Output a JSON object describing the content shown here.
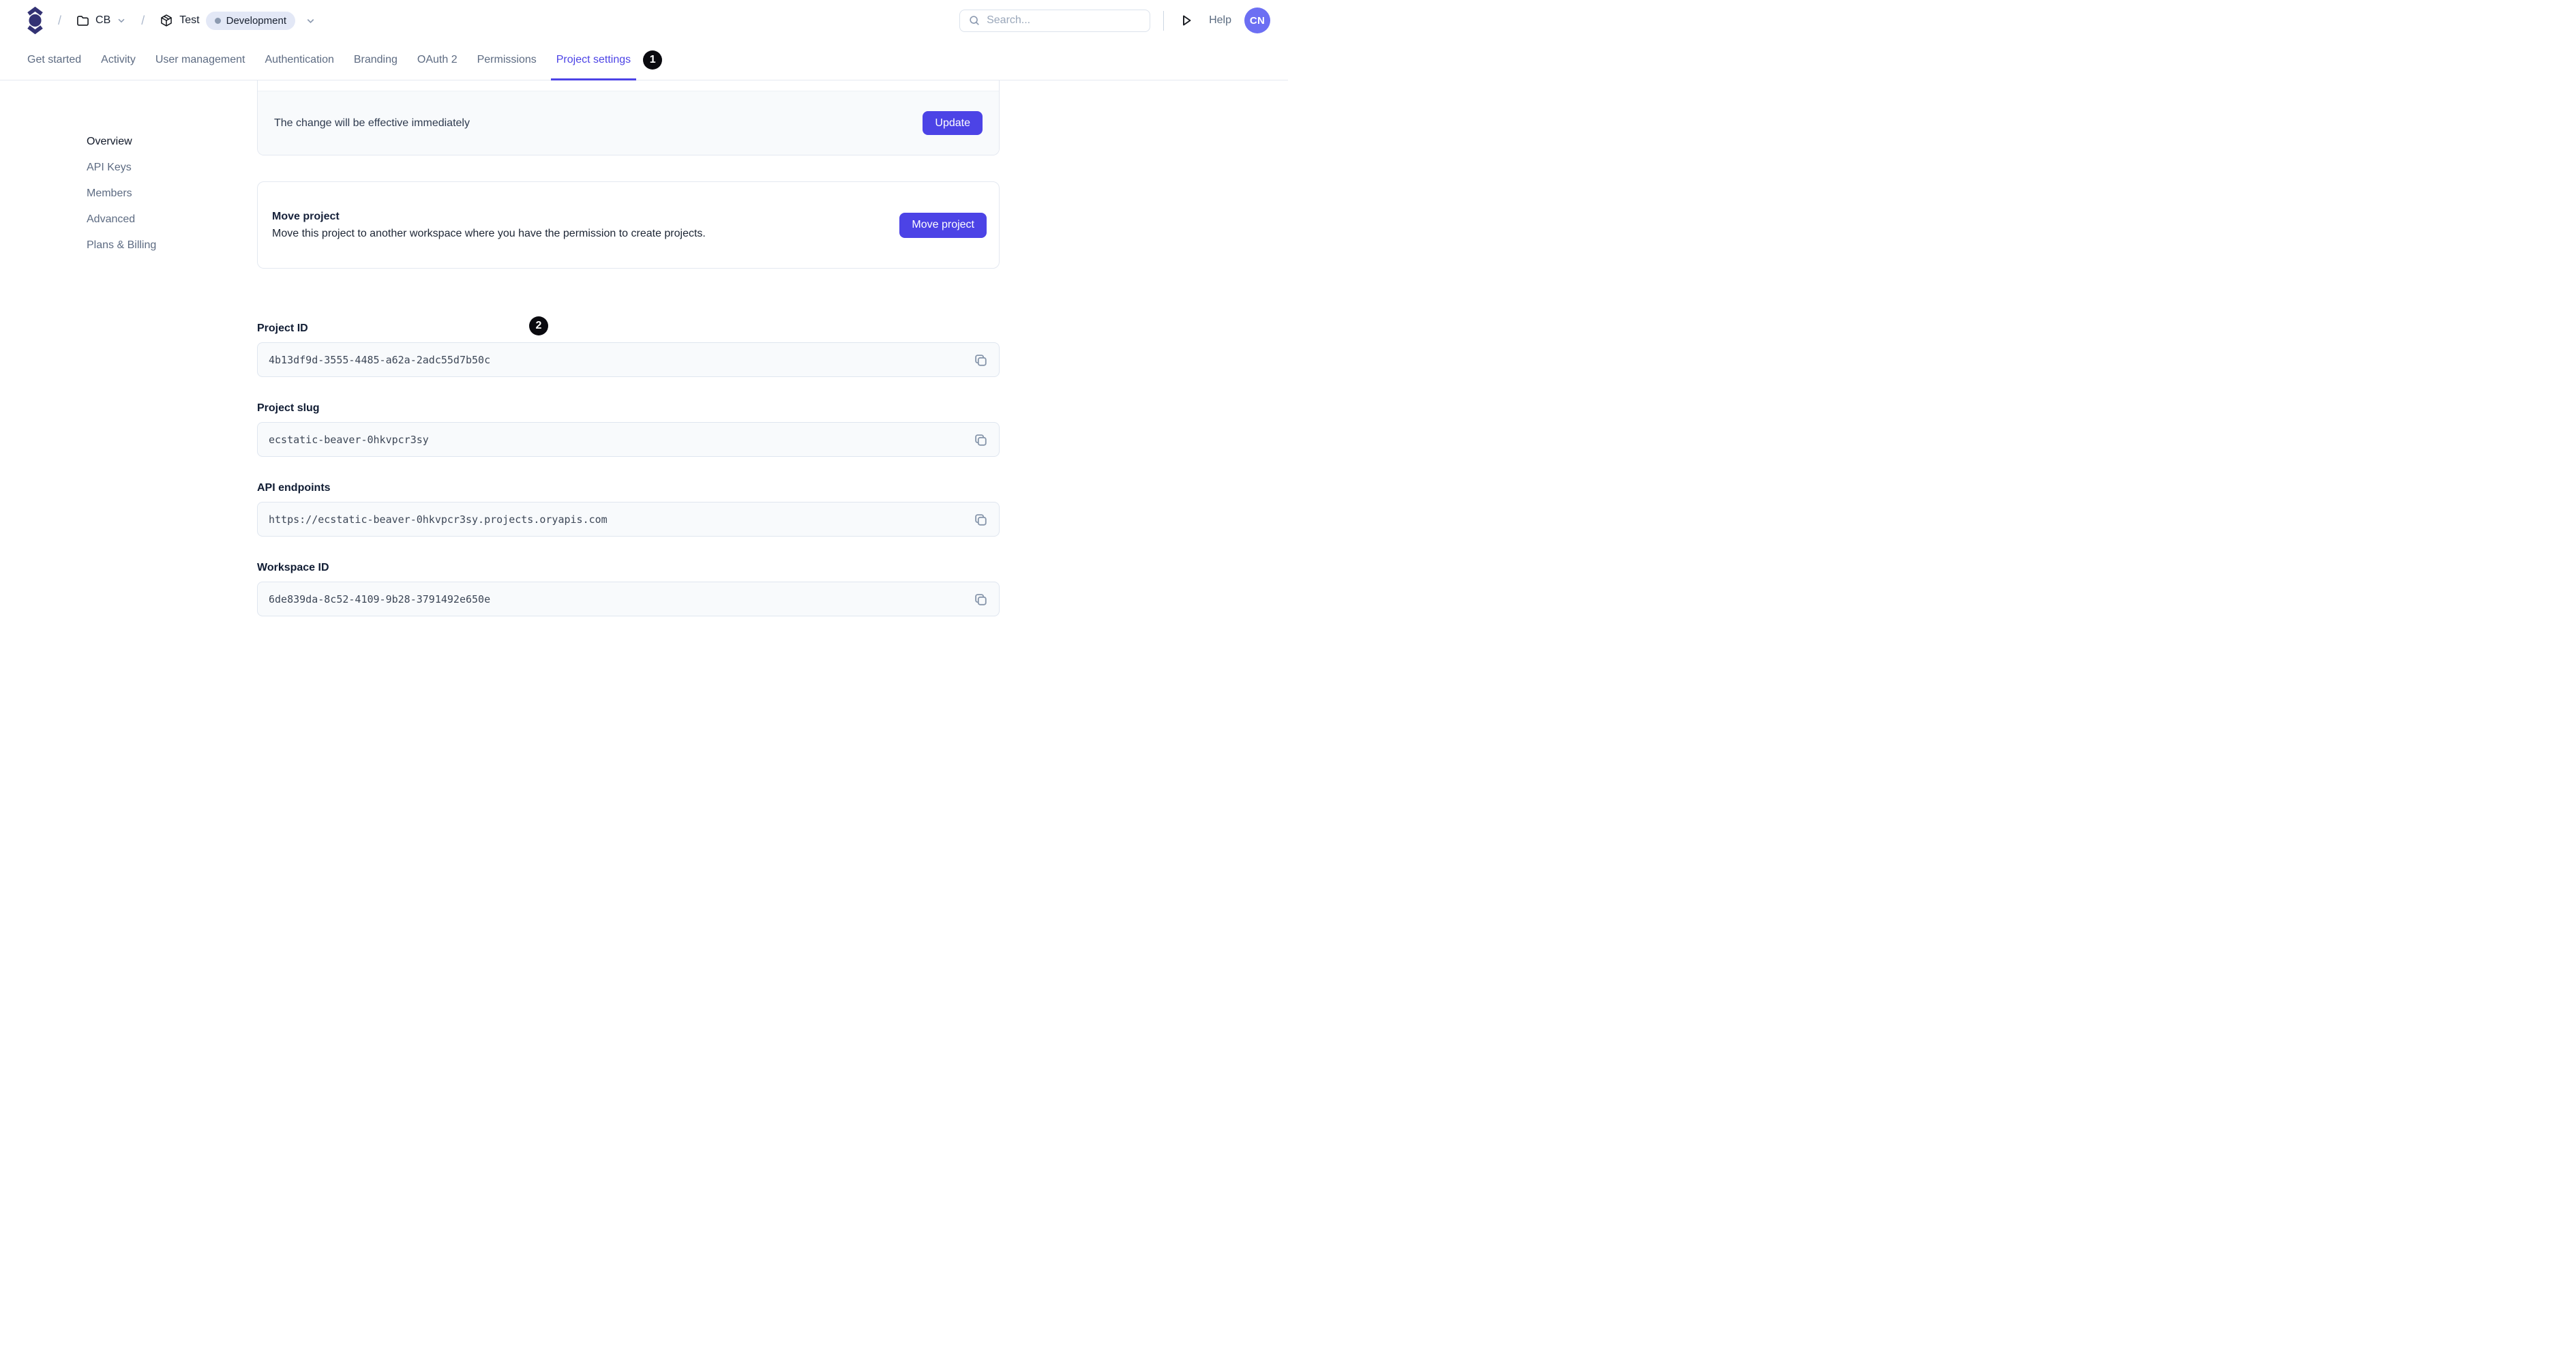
{
  "colors": {
    "accent": "#4c43e6",
    "logo": "#333274",
    "avatar_bg": "#6c6ff3",
    "environment_badge_bg": "#e3e8f6",
    "field_bg": "#f8fafc",
    "annotation_badge_bg": "#0a0a0f"
  },
  "header": {
    "breadcrumb": {
      "separator": "/",
      "workspace_label": "CB",
      "project_label": "Test",
      "environment_badge": "Development"
    },
    "search_placeholder": "Search...",
    "help_label": "Help",
    "avatar_initials": "CN"
  },
  "tabs": {
    "items": [
      {
        "label": "Get started"
      },
      {
        "label": "Activity"
      },
      {
        "label": "User management"
      },
      {
        "label": "Authentication"
      },
      {
        "label": "Branding"
      },
      {
        "label": "OAuth 2"
      },
      {
        "label": "Permissions"
      },
      {
        "label": "Project settings",
        "active": true
      }
    ],
    "annotation_badge_1": "1"
  },
  "sidebar": {
    "items": [
      {
        "label": "Overview",
        "active": true
      },
      {
        "label": "API Keys"
      },
      {
        "label": "Members"
      },
      {
        "label": "Advanced"
      },
      {
        "label": "Plans & Billing"
      }
    ]
  },
  "main": {
    "update_banner": {
      "message": "The change will be effective immediately",
      "button_label": "Update"
    },
    "move_project_card": {
      "title": "Move project",
      "description": "Move this project to another workspace where you have the permission to create projects.",
      "button_label": "Move project"
    },
    "annotation_badge_2": "2",
    "fields": [
      {
        "label": "Project ID",
        "value": "4b13df9d-3555-4485-a62a-2adc55d7b50c"
      },
      {
        "label": "Project slug",
        "value": "ecstatic-beaver-0hkvpcr3sy"
      },
      {
        "label": "API endpoints",
        "value": "https://ecstatic-beaver-0hkvpcr3sy.projects.oryapis.com"
      },
      {
        "label": "Workspace ID",
        "value": "6de839da-8c52-4109-9b28-3791492e650e"
      }
    ]
  }
}
